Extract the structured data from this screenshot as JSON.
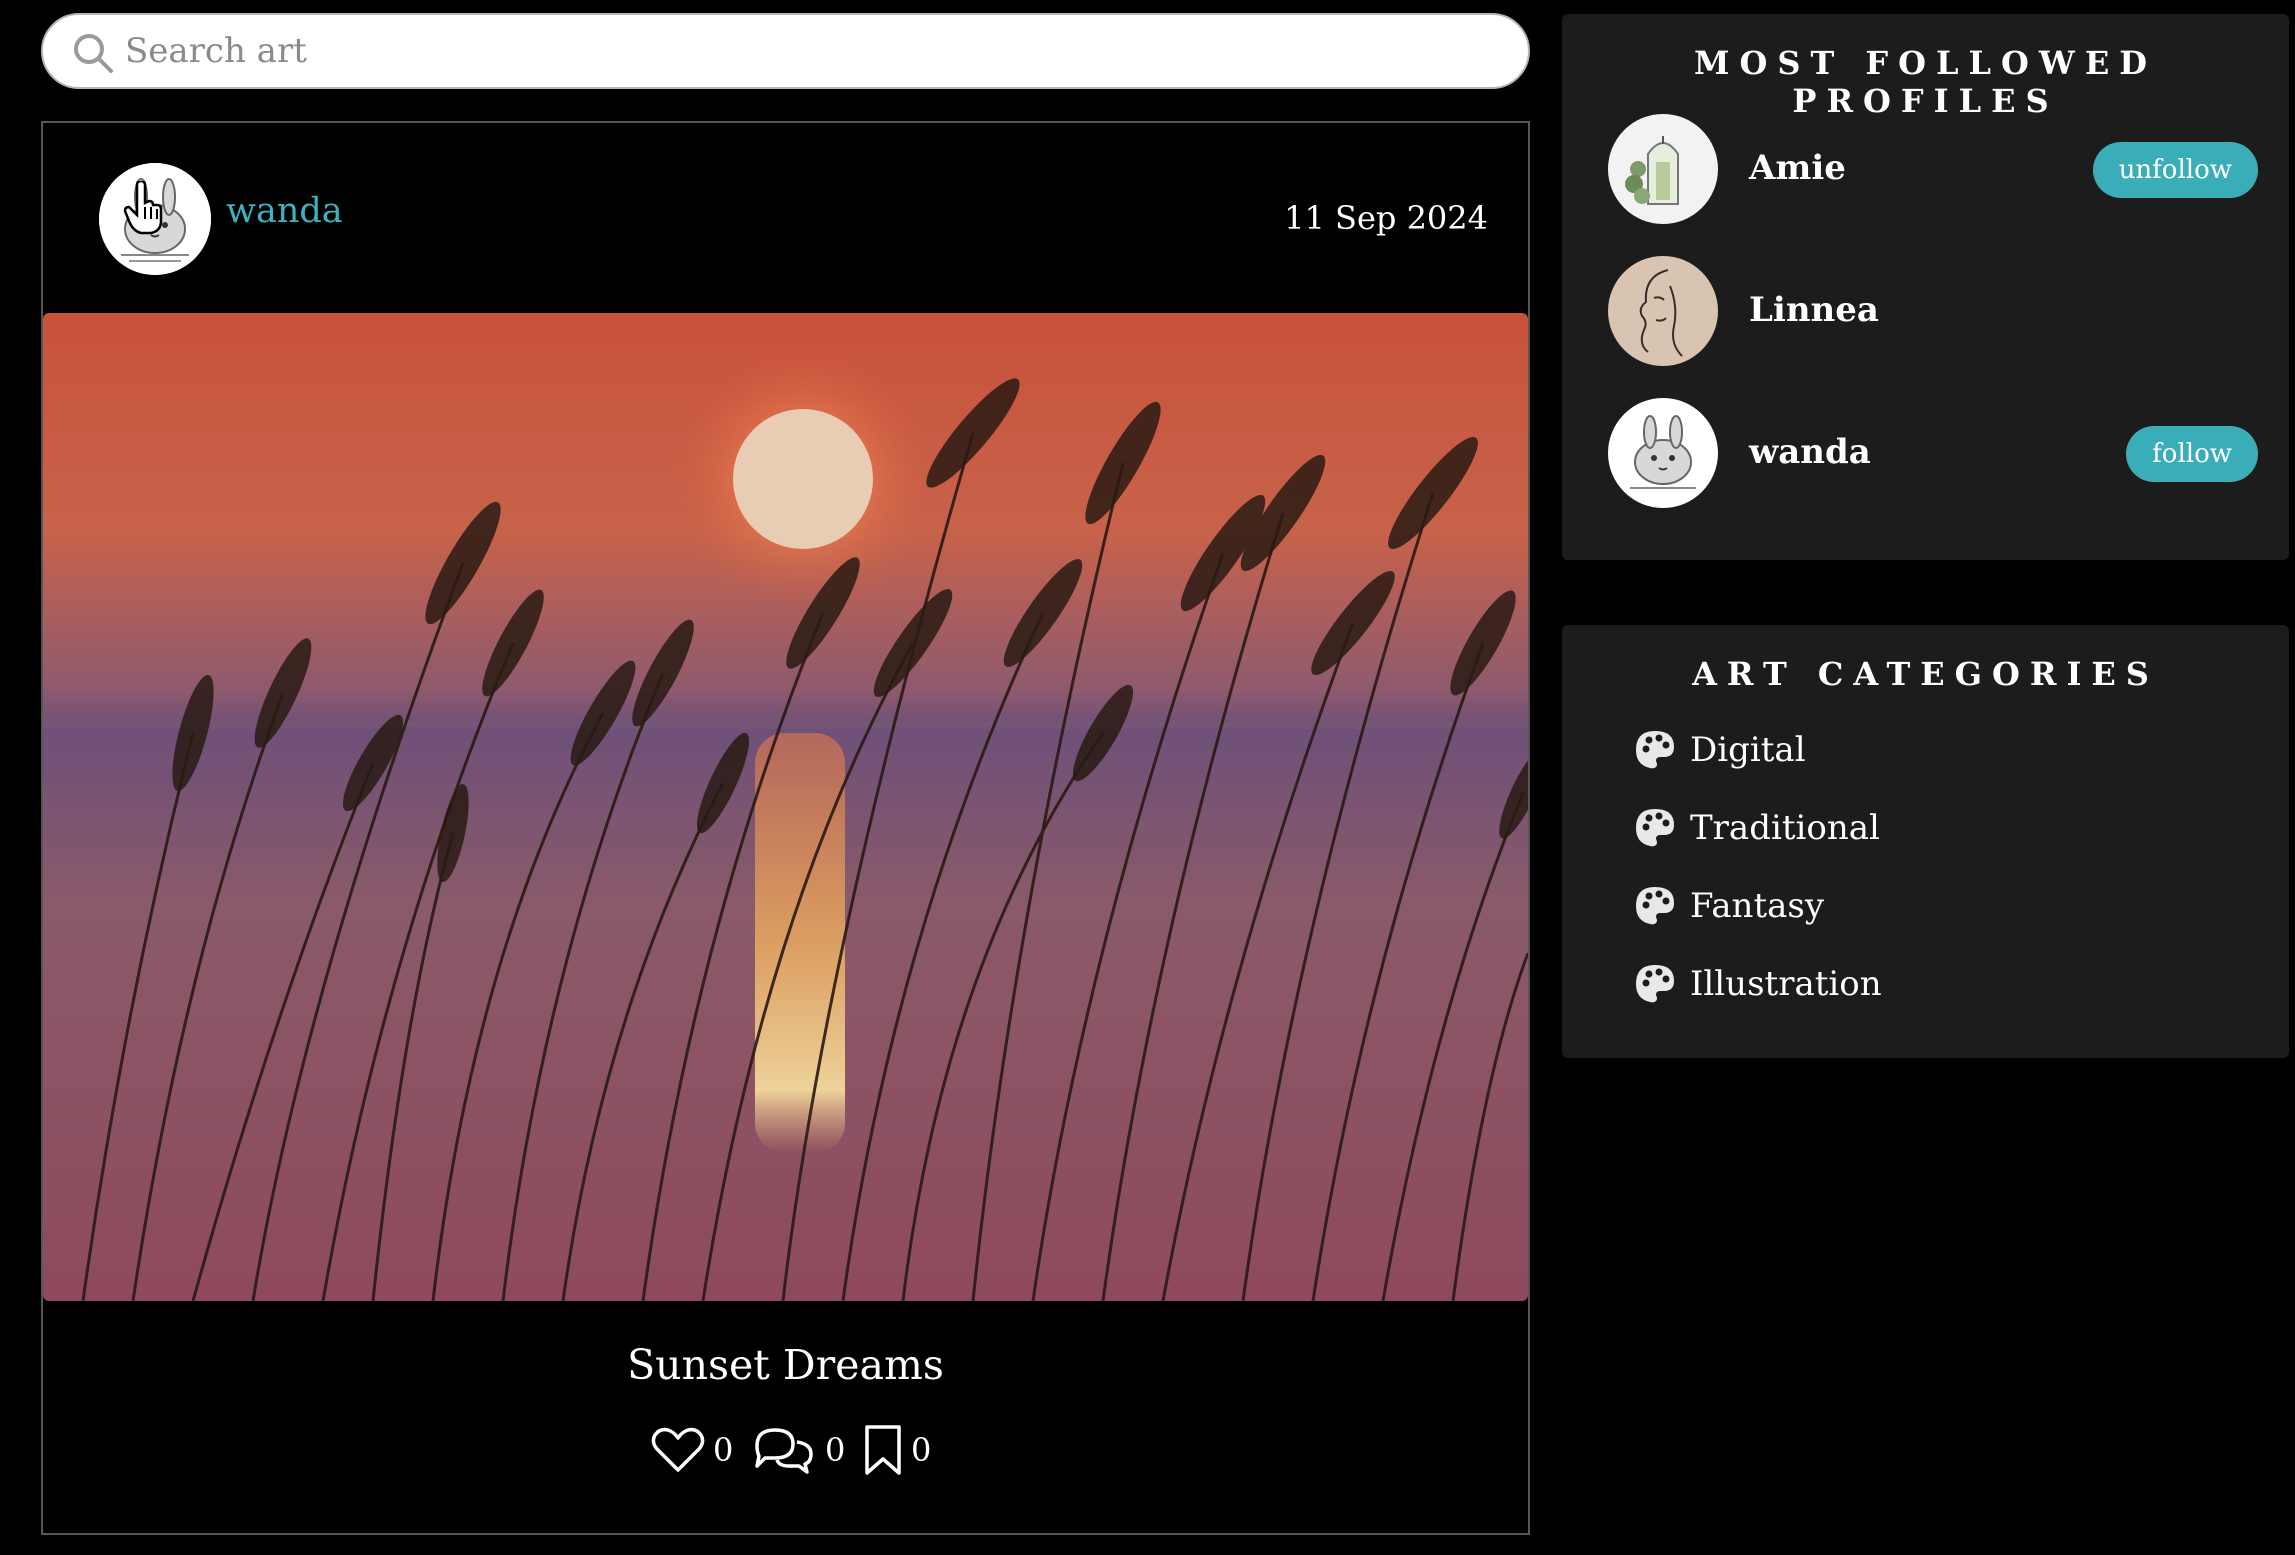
{
  "search": {
    "placeholder": "Search art"
  },
  "post": {
    "author": "wanda",
    "date": "11 Sep 2024",
    "title": "Sunset Dreams",
    "likes": "0",
    "comments": "0",
    "saves": "0"
  },
  "profiles_panel": {
    "title": "MOST FOLLOWED PROFILES",
    "profiles": [
      {
        "name": "Amie",
        "button": "unfollow"
      },
      {
        "name": "Linnea",
        "button": ""
      },
      {
        "name": "wanda",
        "button": "follow"
      }
    ]
  },
  "categories_panel": {
    "title": "ART CATEGORIES",
    "items": [
      {
        "label": "Digital",
        "icon": "palette-icon"
      },
      {
        "label": "Traditional",
        "icon": "palette-icon"
      },
      {
        "label": "Fantasy",
        "icon": "palette-icon"
      },
      {
        "label": "Illustration",
        "icon": "palette-icon"
      }
    ]
  },
  "colors": {
    "accent": "#3aaeb8",
    "author_link": "#3bb3c3",
    "panel_bg": "#1c1c1c",
    "page_bg": "#000000"
  }
}
